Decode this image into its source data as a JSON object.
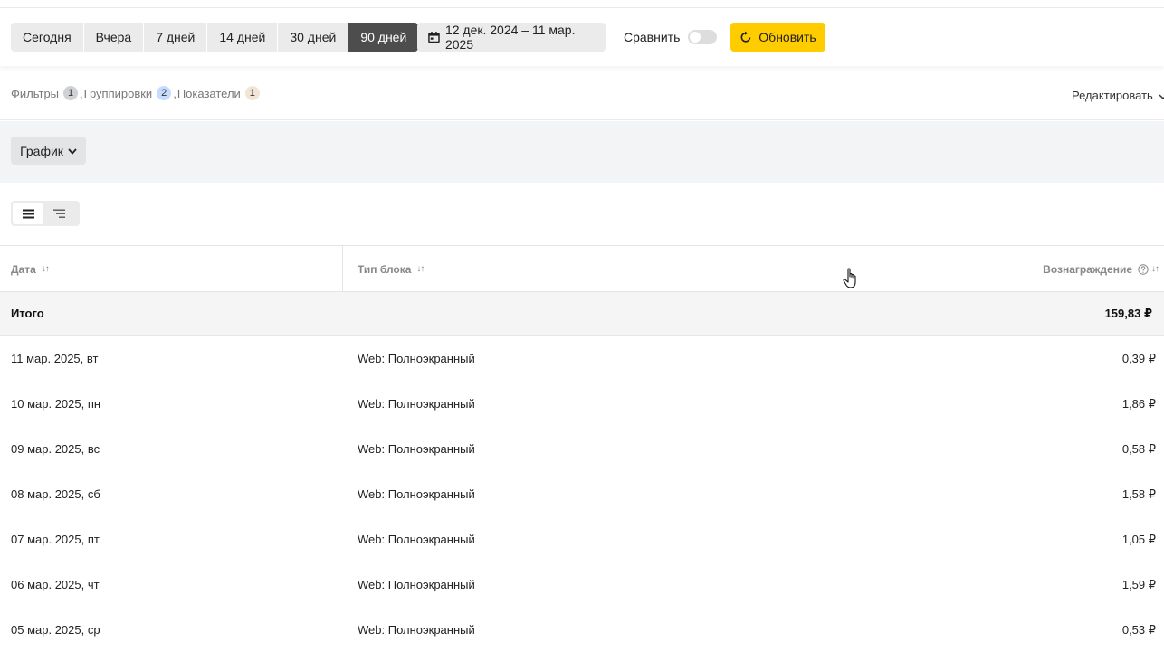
{
  "toolbar": {
    "periods": [
      "Сегодня",
      "Вчера",
      "7 дней",
      "14 дней",
      "30 дней",
      "90 дней"
    ],
    "active_period": "90 дней",
    "date_range": "12 дек. 2024 – 11 мар. 2025",
    "compare_label": "Сравнить",
    "compare_enabled": false,
    "refresh_label": "Обновить",
    "accent_color": "#ffcc00"
  },
  "filters": {
    "filters_label": "Фильтры",
    "filters_count": "1",
    "groupings_label": "Группировки",
    "groupings_count": "2",
    "metrics_label": "Показатели",
    "metrics_count": "1",
    "separator": ",",
    "edit_label": "Редактировать"
  },
  "chart_toggle": {
    "label": "График"
  },
  "view_switch": {
    "active": "list-view"
  },
  "table": {
    "columns": {
      "date": "Дата",
      "block_type": "Тип блока",
      "reward": "Вознаграждение"
    },
    "sort_glyph": "↓↑",
    "total": {
      "label": "Итого",
      "value": "159,83 ₽"
    },
    "rows": [
      {
        "date": "11 мар. 2025, вт",
        "type": "Web: Полноэкранный",
        "value": "0,39 ₽"
      },
      {
        "date": "10 мар. 2025, пн",
        "type": "Web: Полноэкранный",
        "value": "1,86 ₽"
      },
      {
        "date": "09 мар. 2025, вс",
        "type": "Web: Полноэкранный",
        "value": "0,58 ₽"
      },
      {
        "date": "08 мар. 2025, сб",
        "type": "Web: Полноэкранный",
        "value": "1,58 ₽"
      },
      {
        "date": "07 мар. 2025, пт",
        "type": "Web: Полноэкранный",
        "value": "1,05 ₽"
      },
      {
        "date": "06 мар. 2025, чт",
        "type": "Web: Полноэкранный",
        "value": "1,59 ₽"
      },
      {
        "date": "05 мар. 2025, ср",
        "type": "Web: Полноэкранный",
        "value": "0,53 ₽"
      }
    ]
  }
}
